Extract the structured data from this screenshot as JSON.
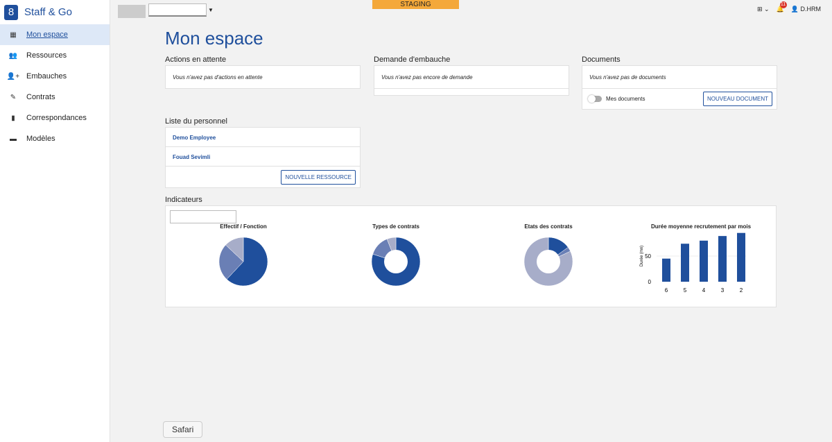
{
  "brand": "Staff & Go",
  "sidebar": {
    "items": [
      {
        "label": "Mon espace",
        "icon": "grid-icon"
      },
      {
        "label": "Ressources",
        "icon": "users-icon"
      },
      {
        "label": "Embauches",
        "icon": "user-plus-icon"
      },
      {
        "label": "Contrats",
        "icon": "contract-icon"
      },
      {
        "label": "Correspondances",
        "icon": "file-icon"
      },
      {
        "label": "Modèles",
        "icon": "folder-icon"
      }
    ]
  },
  "topbar": {
    "env": "STAGING",
    "notifications": "11",
    "user": "D.HRM"
  },
  "page_title": "Mon espace",
  "actions": {
    "title": "Actions en attente",
    "empty": "Vous n'avez pas d'actions en attente"
  },
  "embauche": {
    "title": "Demande d'embauche",
    "empty": "Vous n'avez pas encore de demande"
  },
  "documents": {
    "title": "Documents",
    "empty": "Vous n'avez pas de documents",
    "toggle": "Mes documents",
    "button": "NOUVEAU DOCUMENT"
  },
  "personnel": {
    "title": "Liste du personnel",
    "items": [
      "Demo Employee",
      "Fouad Sevimli"
    ],
    "button": "NOUVELLE RESSOURCE"
  },
  "indicateurs": {
    "title": "Indicateurs"
  },
  "colors": {
    "dark": "#1f4f9c",
    "mid": "#6a7fb5",
    "light": "#a7adc9"
  },
  "chart_data": [
    {
      "type": "pie",
      "title": "Effectif / Fonction",
      "values": [
        62,
        25,
        13
      ]
    },
    {
      "type": "pie",
      "donut": true,
      "title": "Types de contrats",
      "values": [
        80,
        14,
        6
      ]
    },
    {
      "type": "pie",
      "donut": true,
      "title": "Etats des contrats",
      "values": [
        15,
        3,
        82
      ]
    },
    {
      "type": "bar",
      "title": "Durée moyenne recrutement par mois",
      "categories": [
        "6",
        "5",
        "4",
        "3",
        "2"
      ],
      "values": [
        45,
        74,
        80,
        89,
        95
      ],
      "ylabel": "Durée (mn)",
      "yticks": [
        "0",
        "50"
      ],
      "ylim": [
        0,
        100
      ]
    }
  ],
  "dock_tooltip": "Safari"
}
